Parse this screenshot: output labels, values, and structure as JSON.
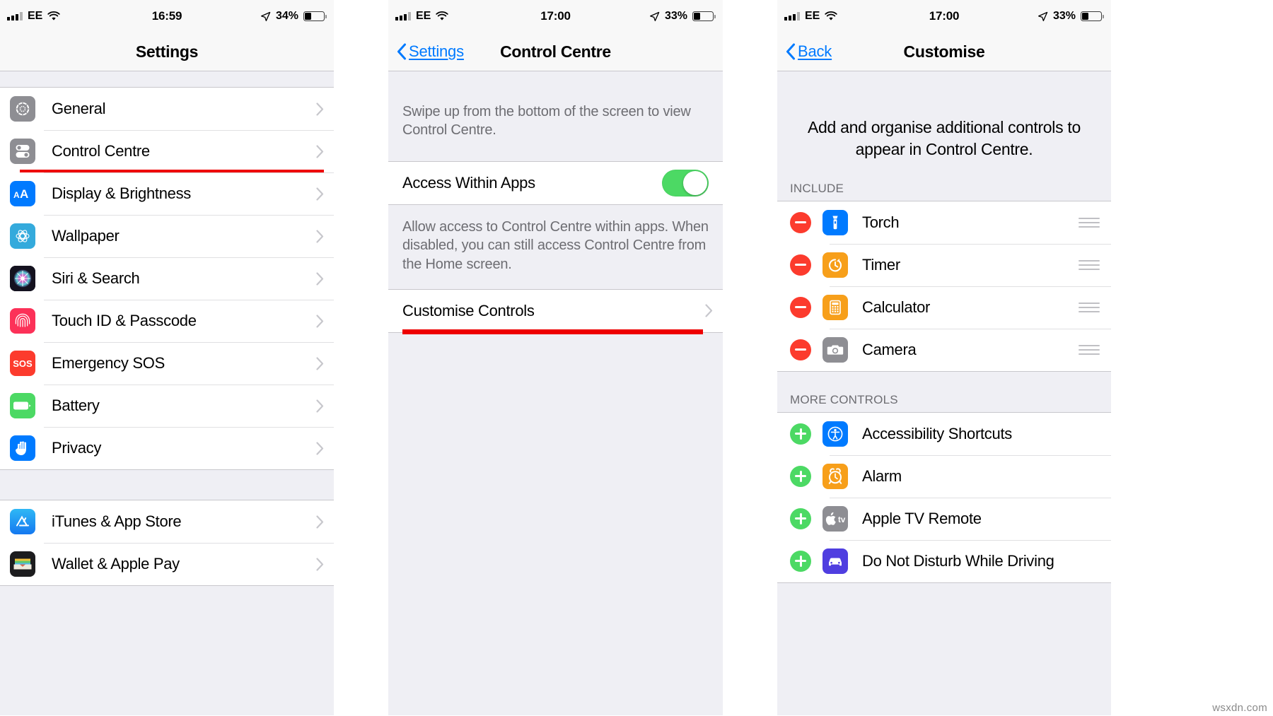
{
  "panels": [
    {
      "id": "settings",
      "status": {
        "signal": "signal-bars",
        "carrier": "EE",
        "wifi": "wifi-icon",
        "time": "16:59",
        "location": "location-arrow-icon",
        "battery_pct": "34%",
        "battery_level": 34
      },
      "nav": {
        "title": "Settings",
        "back_label": null
      },
      "rows": [
        {
          "label": "General",
          "icon": "gear-icon",
          "chevron": true
        },
        {
          "label": "Control Centre",
          "icon": "control-centre-icon",
          "chevron": true,
          "highlight": true
        },
        {
          "label": "Display & Brightness",
          "icon": "display-brightness-icon",
          "chevron": true
        },
        {
          "label": "Wallpaper",
          "icon": "wallpaper-icon",
          "chevron": true
        },
        {
          "label": "Siri & Search",
          "icon": "siri-icon",
          "chevron": true
        },
        {
          "label": "Touch ID & Passcode",
          "icon": "touch-id-icon",
          "chevron": true
        },
        {
          "label": "Emergency SOS",
          "icon": "sos-icon",
          "chevron": true
        },
        {
          "label": "Battery",
          "icon": "battery-icon",
          "chevron": true
        },
        {
          "label": "Privacy",
          "icon": "privacy-hand-icon",
          "chevron": true
        }
      ],
      "rows2": [
        {
          "label": "iTunes & App Store",
          "icon": "app-store-icon",
          "chevron": true
        },
        {
          "label": "Wallet & Apple Pay",
          "icon": "wallet-icon",
          "chevron": true
        }
      ]
    },
    {
      "id": "control-centre",
      "status": {
        "carrier": "EE",
        "time": "17:00",
        "battery_pct": "33%",
        "battery_level": 33
      },
      "nav": {
        "title": "Control Centre",
        "back_label": "Settings"
      },
      "header_note": "Swipe up from the bottom of the screen to view Control Centre.",
      "toggle_row": {
        "label": "Access Within Apps",
        "value": "on"
      },
      "footer_note": "Allow access to Control Centre within apps. When disabled, you can still access Control Centre from the Home screen.",
      "customise_row": {
        "label": "Customise Controls",
        "chevron": true,
        "highlight": true
      }
    },
    {
      "id": "customise",
      "status": {
        "carrier": "EE",
        "time": "17:00",
        "battery_pct": "33%",
        "battery_level": 33
      },
      "nav": {
        "title": "Customise",
        "back_label": "Back"
      },
      "intro_note": "Add and organise additional controls to appear in Control Centre.",
      "include_header": "INCLUDE",
      "include": [
        {
          "label": "Torch",
          "icon": "torch-icon",
          "action": "remove"
        },
        {
          "label": "Timer",
          "icon": "timer-icon",
          "action": "remove"
        },
        {
          "label": "Calculator",
          "icon": "calculator-icon",
          "action": "remove"
        },
        {
          "label": "Camera",
          "icon": "camera-icon",
          "action": "remove"
        }
      ],
      "more_header": "MORE CONTROLS",
      "more": [
        {
          "label": "Accessibility Shortcuts",
          "icon": "accessibility-icon",
          "action": "add"
        },
        {
          "label": "Alarm",
          "icon": "alarm-icon",
          "action": "add"
        },
        {
          "label": "Apple TV Remote",
          "icon": "apple-tv-icon",
          "action": "add"
        },
        {
          "label": "Do Not Disturb While Driving",
          "icon": "dnd-driving-icon",
          "action": "add"
        }
      ]
    }
  ],
  "colors": {
    "accent_blue": "#007aff",
    "annotation_red": "#ee0000",
    "toggle_green": "#4cd964",
    "remove_red": "#fc3b2d",
    "add_green": "#4cd964",
    "group_bg": "#efeff4"
  },
  "watermark": "wsxdn.com"
}
